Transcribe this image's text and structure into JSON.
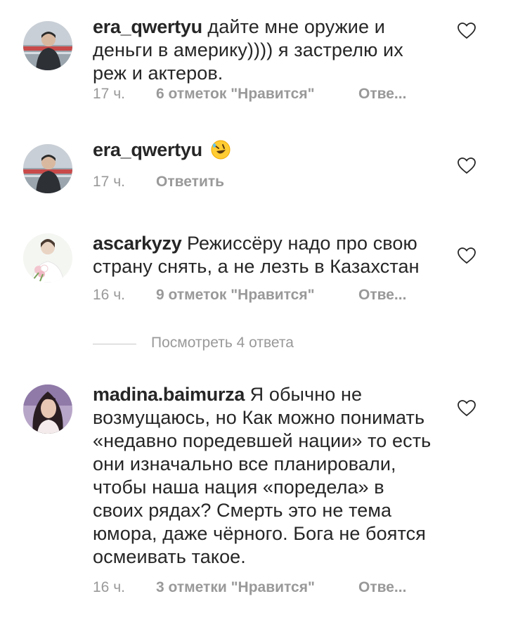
{
  "comments": [
    {
      "username": "era_qwertyu",
      "text": "дайте мне оружие и деньги в америку)))) я застрелю их реж и актеров.",
      "time": "17 ч.",
      "likes": "6 отметок \"Нравится\"",
      "reply": "Отве..."
    },
    {
      "username": "era_qwertyu",
      "text": "",
      "emoji": "rolling-on-floor-laughing-emoji",
      "time": "17 ч.",
      "reply": "Ответить"
    },
    {
      "username": "ascarkyzy",
      "text": "Режиссёру надо про свою страну снять, а не лезть в Казахстан",
      "time": "16 ч.",
      "likes": "9 отметок \"Нравится\"",
      "reply": "Отве..."
    },
    {
      "username": "madina.baimurza",
      "text": "Я обычно не возмущаюсь, но Как можно понимать «недавно поредевшей нации» то есть они изначально все планировали, чтобы наша нация «поредела» в своих рядах? Смерть это не тема юмора, даже чёрного. Бога не боятся осмеивать такое.",
      "time": "16 ч.",
      "likes": "3 отметки \"Нравится\"",
      "reply": "Отве..."
    }
  ],
  "view_replies": "Посмотреть 4 ответа",
  "colors": {
    "text": "#262626",
    "secondary": "#999999",
    "divider": "#c7c7c7"
  }
}
